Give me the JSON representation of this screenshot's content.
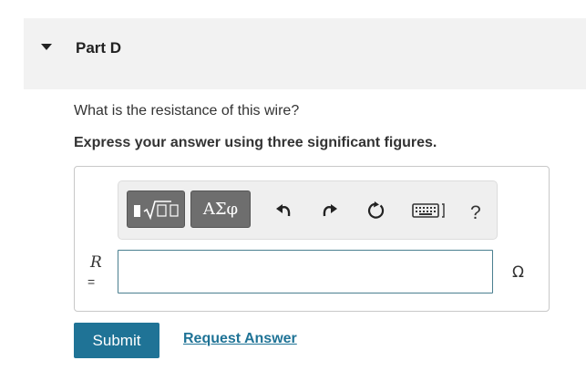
{
  "part": {
    "title": "Part D",
    "question": "What is the resistance of this wire?",
    "instruction": "Express your answer using three significant figures."
  },
  "toolbar": {
    "templates_icon": "templates-radical-icon",
    "symbols_label": "ΑΣφ",
    "undo_icon": "undo-icon",
    "redo_icon": "redo-icon",
    "reset_icon": "reset-icon",
    "keyboard_icon": "keyboard-icon",
    "help_label": "?"
  },
  "answer": {
    "variable": "R",
    "equals": "=",
    "value": "",
    "unit": "Ω"
  },
  "actions": {
    "submit_label": "Submit",
    "request_label": "Request Answer"
  },
  "colors": {
    "accent": "#1f7396",
    "header_bg": "#f2f2f2",
    "toolbar_button": "#6e6e6e"
  }
}
